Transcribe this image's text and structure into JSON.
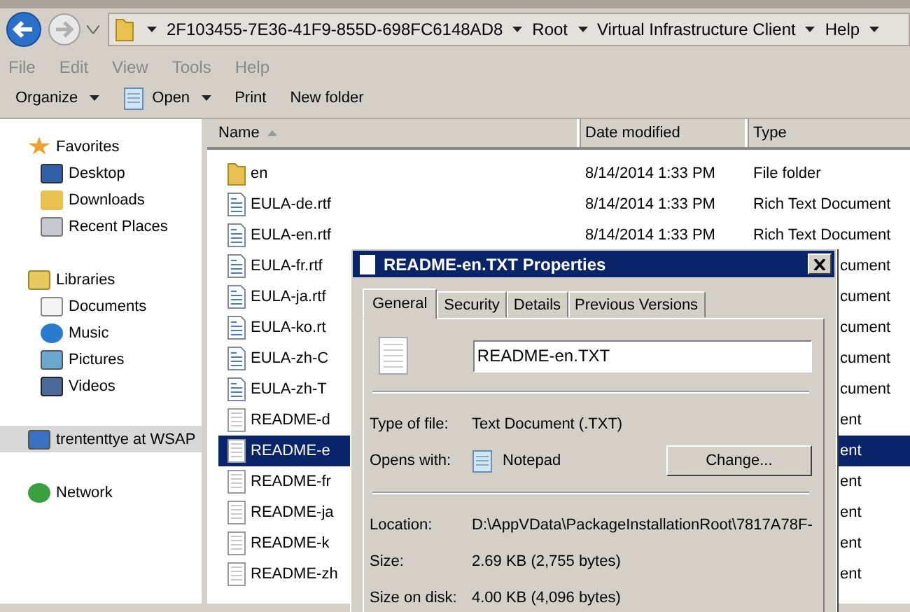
{
  "address_bar": {
    "breadcrumbs": [
      "2F103455-7E36-41F9-855D-698FC6148AD8",
      "Root",
      "Virtual Infrastructure Client",
      "Help"
    ]
  },
  "menu": [
    "File",
    "Edit",
    "View",
    "Tools",
    "Help"
  ],
  "toolbar": [
    {
      "label": "Organize",
      "kind": "dropdown"
    },
    {
      "label": "Open",
      "kind": "split"
    },
    {
      "label": "Print",
      "kind": "plain"
    },
    {
      "label": "New folder",
      "kind": "plain"
    }
  ],
  "navigation": [
    {
      "label": "Favorites",
      "kind": "star",
      "selected": false,
      "children": [
        {
          "label": "Desktop",
          "kind": "desktop",
          "selected": false
        },
        {
          "label": "Downloads",
          "kind": "downloads",
          "selected": false
        },
        {
          "label": "Recent Places",
          "kind": "recent",
          "selected": false
        }
      ]
    },
    {
      "label": "Libraries",
      "kind": "libraries",
      "selected": false,
      "children": [
        {
          "label": "Documents",
          "kind": "documents",
          "selected": false
        },
        {
          "label": "Music",
          "kind": "music",
          "selected": false
        },
        {
          "label": "Pictures",
          "kind": "pictures",
          "selected": false
        },
        {
          "label": "Videos",
          "kind": "videos",
          "selected": false
        }
      ]
    },
    {
      "label": "trententtye at WSAP",
      "kind": "computer",
      "selected": true
    },
    {
      "label": "Network",
      "kind": "network",
      "selected": false
    }
  ],
  "file_list": {
    "columns": [
      {
        "label": "Name",
        "sorted": true
      },
      {
        "label": "Date modified",
        "sorted": false
      },
      {
        "label": "Type",
        "sorted": false
      }
    ],
    "rows": [
      {
        "name": "en",
        "kind": "folder",
        "date": "8/14/2014 1:33 PM",
        "type": "File folder",
        "selected": false
      },
      {
        "name": "EULA-de.rtf",
        "kind": "rtf",
        "date": "8/14/2014 1:33 PM",
        "type": "Rich Text Document",
        "selected": false
      },
      {
        "name": "EULA-en.rtf",
        "kind": "rtf",
        "date": "8/14/2014 1:33 PM",
        "type": "Rich Text Document",
        "selected": false
      },
      {
        "name": "EULA-fr.rtf",
        "kind": "rtf",
        "type": "cument",
        "selected": false
      },
      {
        "name": "EULA-ja.rtf",
        "kind": "rtf",
        "type": "cument",
        "selected": false
      },
      {
        "name": "EULA-ko.rt",
        "kind": "rtf",
        "type": "cument",
        "selected": false
      },
      {
        "name": "EULA-zh-C",
        "kind": "rtf",
        "type": "cument",
        "selected": false
      },
      {
        "name": "EULA-zh-T",
        "kind": "rtf",
        "type": "cument",
        "selected": false
      },
      {
        "name": "README-d",
        "kind": "txt",
        "type": "ent",
        "selected": false
      },
      {
        "name": "README-e",
        "kind": "txt",
        "type": "ent",
        "selected": true
      },
      {
        "name": "README-fr",
        "kind": "txt",
        "type": "ent",
        "selected": false
      },
      {
        "name": "README-ja",
        "kind": "txt",
        "type": "ent",
        "selected": false
      },
      {
        "name": "README-k",
        "kind": "txt",
        "type": "ent",
        "selected": false
      },
      {
        "name": "README-zh",
        "kind": "txt",
        "type": "ent",
        "selected": false
      }
    ]
  },
  "dialog": {
    "title": "README-en.TXT Properties",
    "tabs": [
      {
        "label": "General",
        "selected": true
      },
      {
        "label": "Security",
        "selected": false
      },
      {
        "label": "Details",
        "selected": false
      },
      {
        "label": "Previous Versions",
        "selected": false
      }
    ],
    "file_name": "README-en.TXT",
    "type_of_file": {
      "label": "Type of file:",
      "value": "Text Document (.TXT)"
    },
    "opens_with": {
      "label": "Opens with:",
      "value": "Notepad",
      "button": "Change..."
    },
    "details": [
      {
        "label": "Location:",
        "value": "D:\\AppVData\\PackageInstallationRoot\\7817A78F-"
      },
      {
        "label": "Size:",
        "value": "2.69 KB (2,755 bytes)"
      },
      {
        "label": "Size on disk:",
        "value": "4.00 KB (4,096 bytes)"
      }
    ]
  }
}
